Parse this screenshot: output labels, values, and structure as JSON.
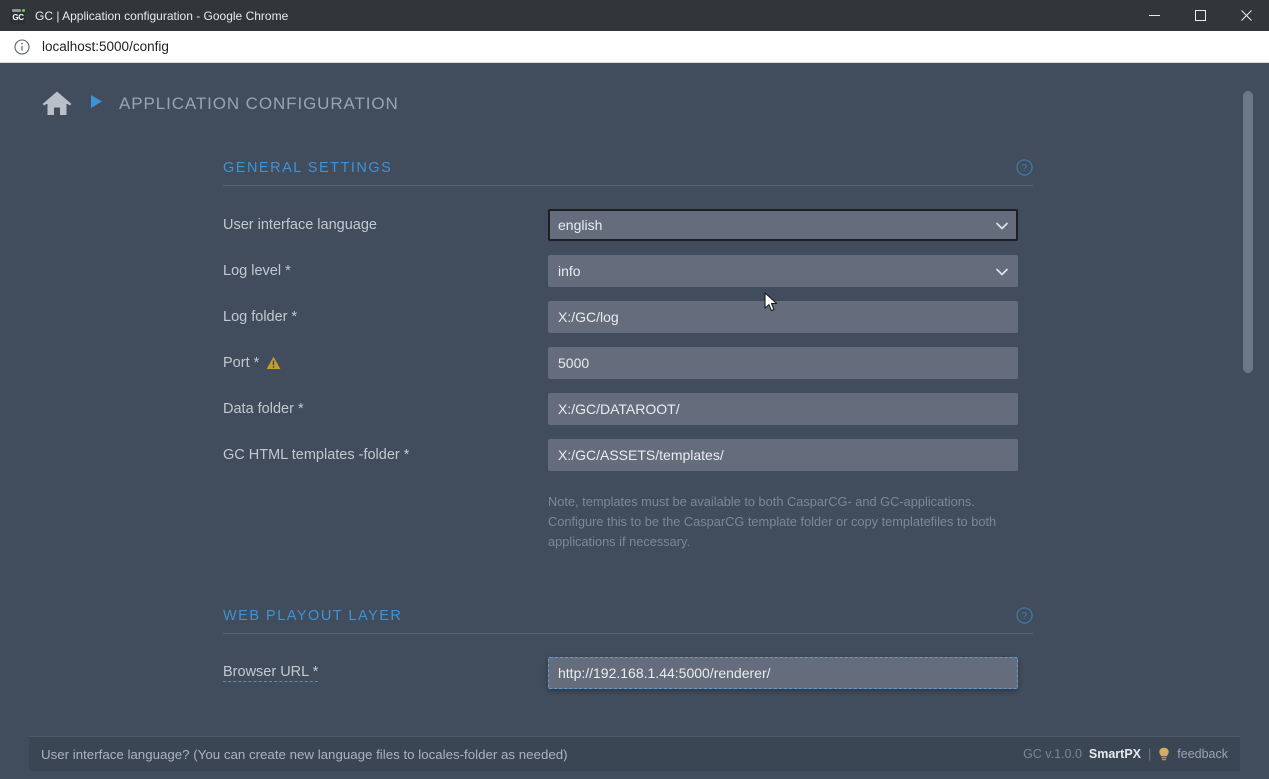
{
  "window": {
    "title": "GC | Application configuration - Google Chrome",
    "favicon_label": "GC",
    "favicon_name": "gc-favicon",
    "minimize_label": "Minimize",
    "maximize_label": "Maximize",
    "close_label": "Close"
  },
  "omnibox": {
    "url": "localhost:5000/config",
    "info_icon": "info-circle-icon"
  },
  "app_header": {
    "home_icon": "home-icon",
    "arrow_icon": "play-triangle-icon",
    "title": "APPLICATION CONFIGURATION"
  },
  "sections": [
    {
      "title": "GENERAL SETTINGS",
      "help_icon": "help-circle-icon",
      "rows": [
        {
          "label": "User interface language",
          "type": "select",
          "value": "english",
          "state": "focused",
          "name": "user-interface-language"
        },
        {
          "label": "Log level *",
          "type": "select",
          "value": "info",
          "state": "normal",
          "name": "log-level"
        },
        {
          "label": "Log folder *",
          "type": "text",
          "value": "X:/GC/log",
          "state": "normal",
          "name": "log-folder"
        },
        {
          "label": "Port *",
          "type": "text",
          "value": "5000",
          "state": "normal",
          "warning_icon": "warning-triangle-icon",
          "name": "port"
        },
        {
          "label": "Data folder *",
          "type": "text",
          "value": "X:/GC/DATAROOT/",
          "state": "normal",
          "name": "data-folder"
        },
        {
          "label": "GC HTML templates -folder *",
          "type": "text",
          "value": "X:/GC/ASSETS/templates/",
          "state": "normal",
          "name": "gc-html-templates-folder"
        }
      ],
      "note": "Note, templates must be available to both CasparCG- and GC-applications. Configure this to be the CasparCG template folder or copy templatefiles to both applications if necessary."
    },
    {
      "title": "WEB PLAYOUT LAYER",
      "help_icon": "help-circle-icon",
      "rows": [
        {
          "label": "Browser URL *",
          "type": "text",
          "value": "http://192.168.1.44:5000/renderer/",
          "state": "highlighted",
          "name": "browser-url"
        }
      ]
    }
  ],
  "footer": {
    "message": "User interface language? (You can create new language files to locales-folder as needed)",
    "version": "GC v.1.0.0",
    "brand": "SmartPX",
    "separator": "|",
    "bulb_icon": "lightbulb-icon",
    "feedback": "feedback"
  },
  "colors": {
    "page_bg": "#414d5c",
    "field_bg": "#656d7c",
    "accent_blue": "#3e92d6",
    "warning_amber": "#c99a2e",
    "label_gray": "#c2c8d0"
  }
}
